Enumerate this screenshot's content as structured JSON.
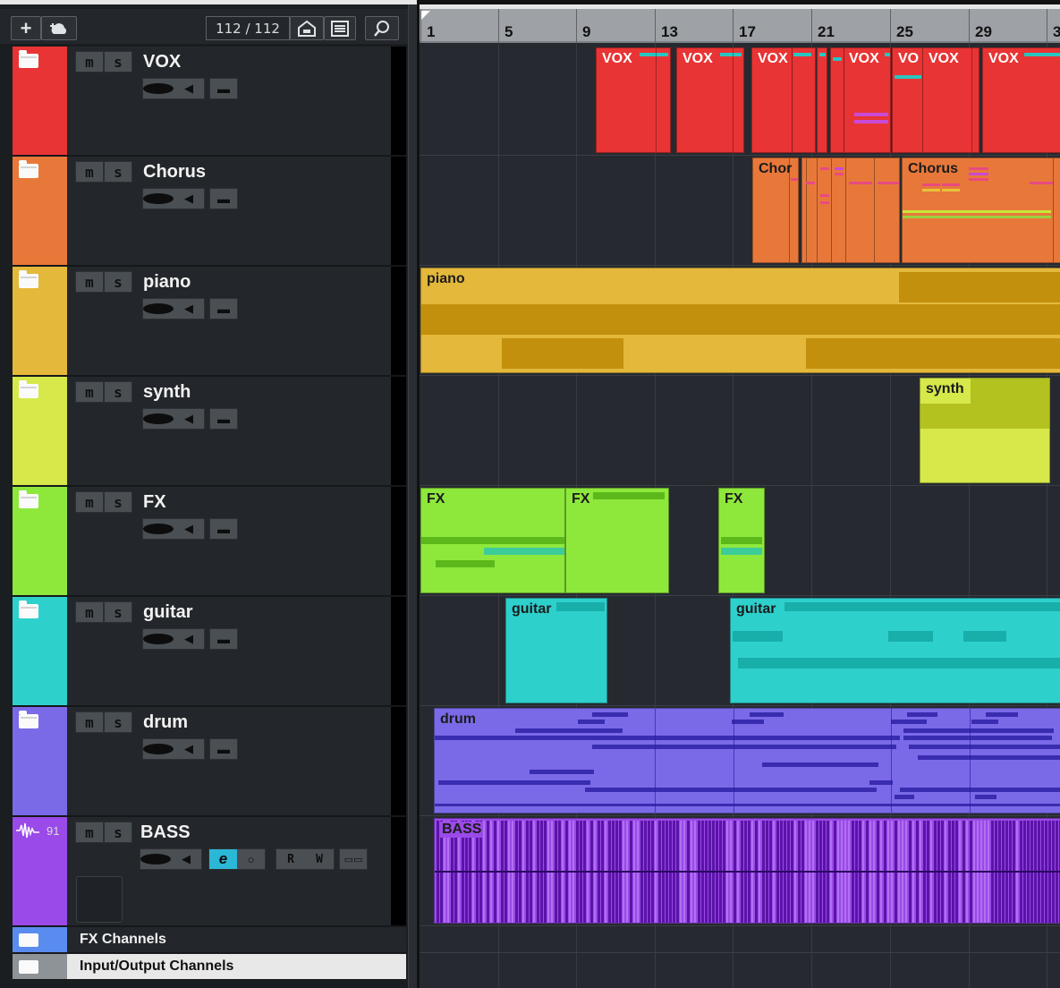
{
  "toolbar": {
    "add_track_icon": "plus-icon",
    "add_from_cloud_icon": "cloud-add-icon",
    "track_count": "112 / 112",
    "visibility_icon": "house-visibility-icon",
    "list_icon": "list-icon",
    "search_icon": "search-icon"
  },
  "ruler": {
    "bars": [
      "1",
      "5",
      "9",
      "13",
      "17",
      "21",
      "25",
      "29",
      "3"
    ]
  },
  "tracks": [
    {
      "name": "VOX",
      "color": "#e83434",
      "m": "m",
      "s": "s"
    },
    {
      "name": "Chorus",
      "color": "#e8783a",
      "m": "m",
      "s": "s"
    },
    {
      "name": "piano",
      "color": "#e4b83a",
      "m": "m",
      "s": "s"
    },
    {
      "name": "synth",
      "color": "#d6e84a",
      "m": "m",
      "s": "s"
    },
    {
      "name": "FX",
      "color": "#8ee83c",
      "m": "m",
      "s": "s"
    },
    {
      "name": "guitar",
      "color": "#2ed0cc",
      "m": "m",
      "s": "s"
    },
    {
      "name": "drum",
      "color": "#7a6ae8",
      "m": "m",
      "s": "s"
    },
    {
      "name": "BASS",
      "color": "#9a4ae8",
      "m": "m",
      "s": "s",
      "number": "91",
      "r": "R",
      "w": "W"
    }
  ],
  "special_rows": {
    "fx_channels": "FX Channels",
    "io_channels": "Input/Output Channels"
  },
  "clips": {
    "vox": [
      "VOX",
      "VOX",
      "VOX",
      "VOX",
      "VO",
      "VOX",
      "VOX"
    ],
    "chorus": [
      "Chor",
      "Chorus"
    ],
    "piano": "piano",
    "synth": "synth",
    "fx": [
      "FX",
      "FX",
      "FX"
    ],
    "guitar": [
      "guitar",
      "guitar"
    ],
    "drum": "drum",
    "bass": "BASS"
  },
  "colors": {
    "vox": "#e83434",
    "chorus": "#e8783a",
    "piano": "#e4b83a",
    "synth": "#d6e84a",
    "fx": "#8ee83c",
    "guitar": "#2ed0cc",
    "drum": "#7a6ae8",
    "bass": "#9a4ae8",
    "fx_channels_strip": "#5a8cf0"
  }
}
